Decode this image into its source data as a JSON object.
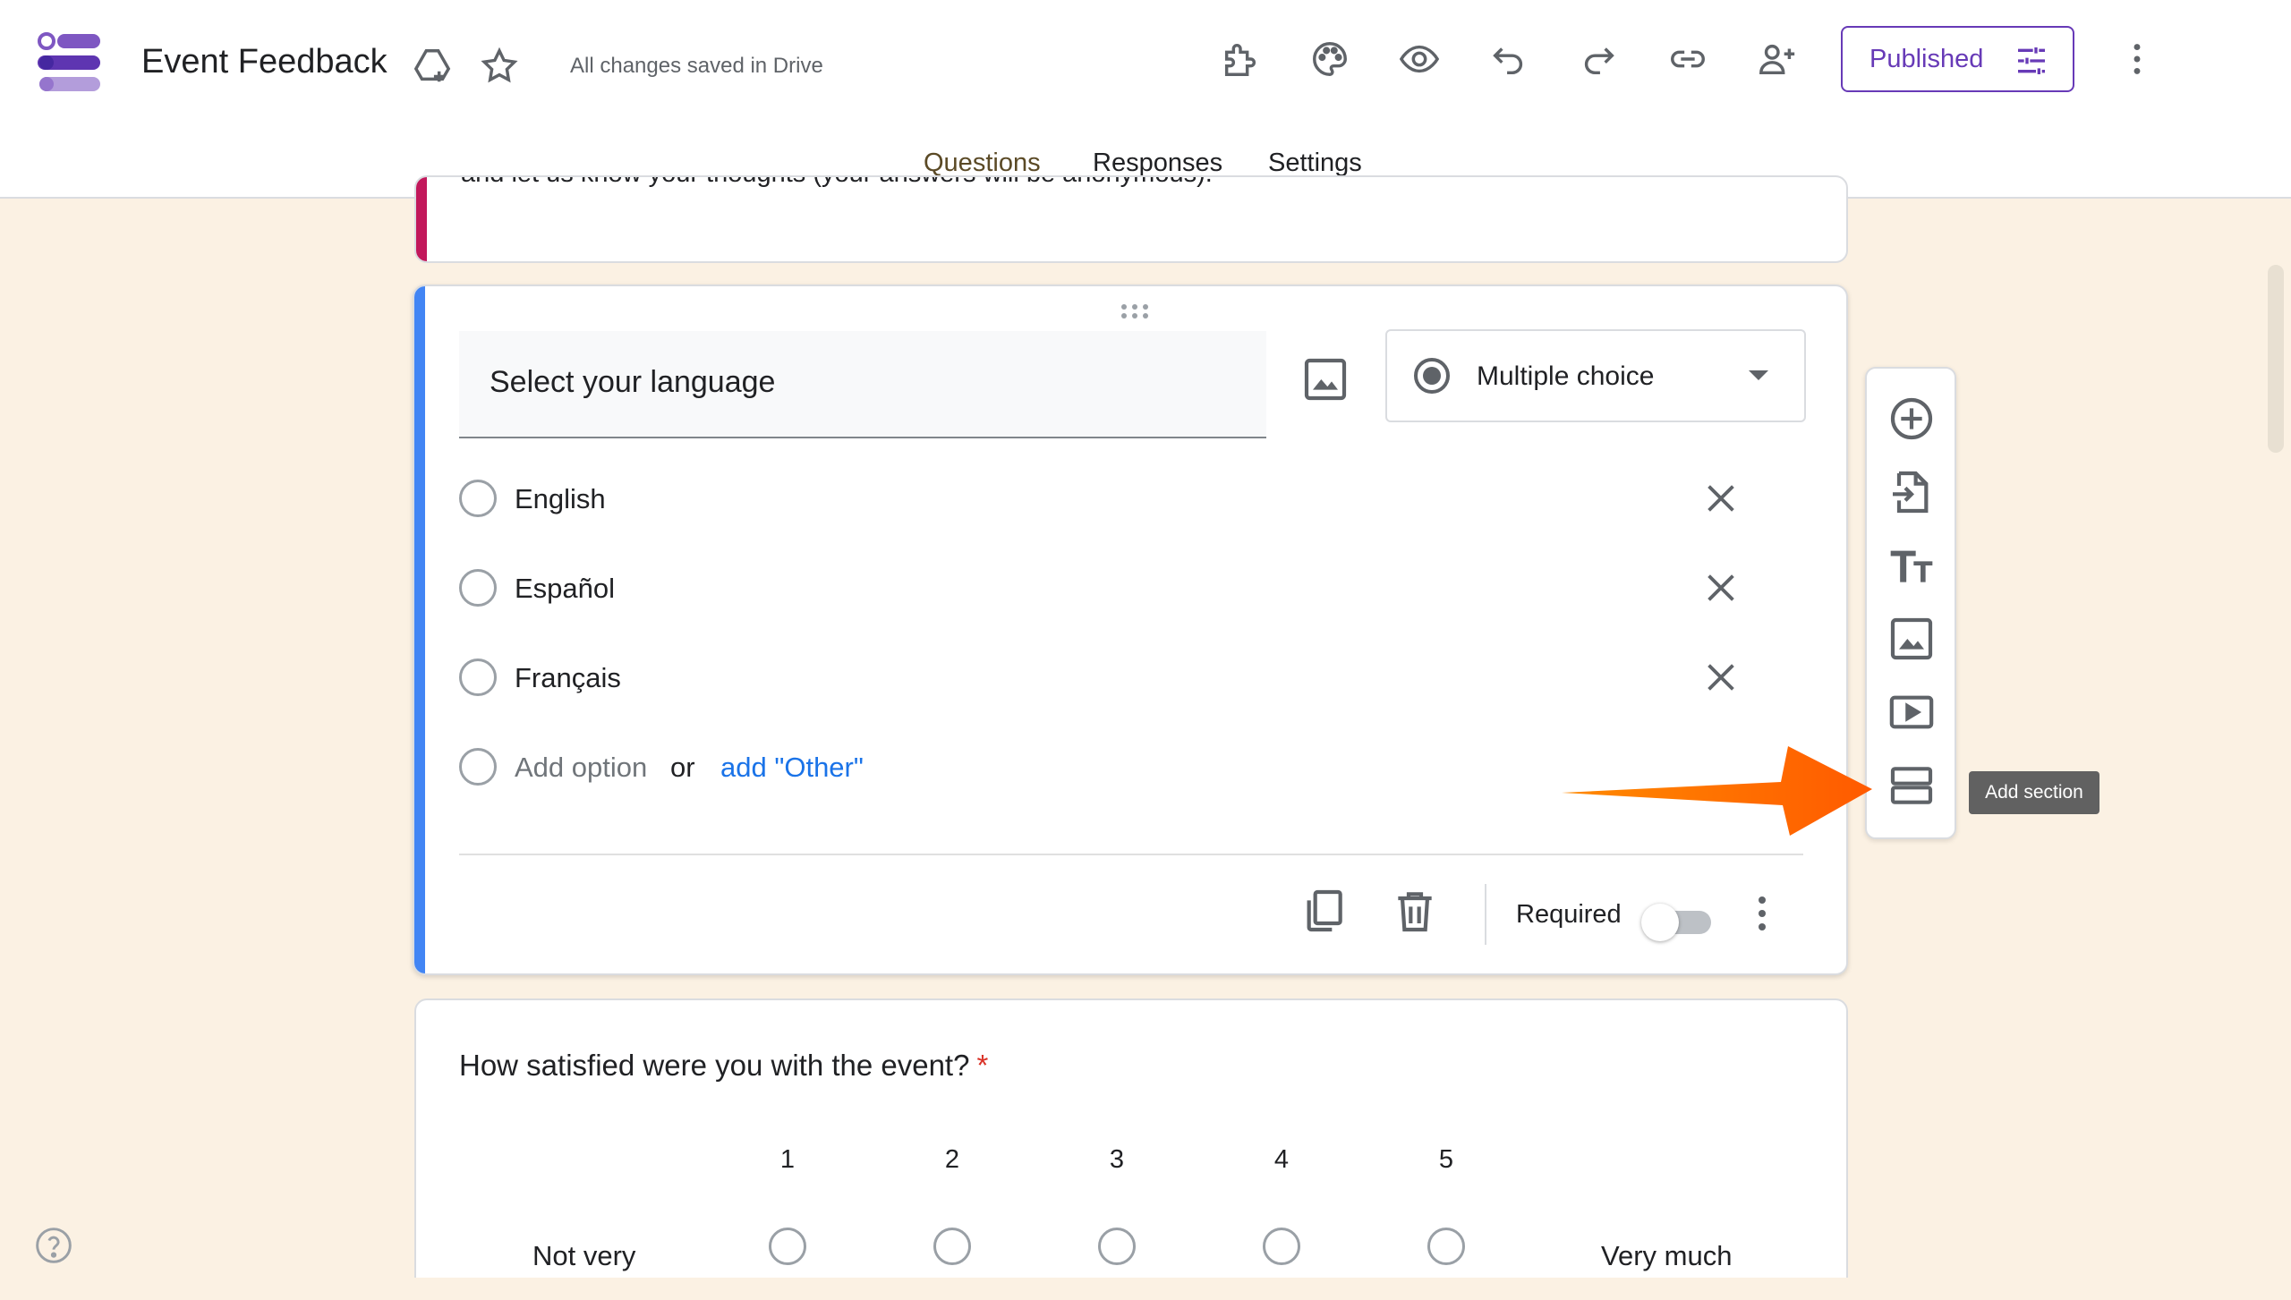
{
  "header": {
    "title": "Event Feedback",
    "saved_status": "All changes saved in Drive",
    "published_label": "Published",
    "icons": [
      "move-to-folder-icon",
      "star-icon",
      "addons-icon",
      "palette-icon",
      "preview-icon",
      "undo-icon",
      "redo-icon",
      "link-icon",
      "add-collaborator-icon",
      "more-icon"
    ]
  },
  "tabs": [
    {
      "label": "Questions",
      "active": true
    },
    {
      "label": "Responses",
      "active": false
    },
    {
      "label": "Settings",
      "active": false
    }
  ],
  "description": {
    "text": "and let us know your thoughts (your answers will be anonymous)."
  },
  "question": {
    "title": "Select your language",
    "type": "Multiple choice",
    "options": [
      "English",
      "Español",
      "Français"
    ],
    "add_option": "Add option",
    "or": "or",
    "add_other": "add \"Other\"",
    "required_label": "Required",
    "required": false
  },
  "satisfaction": {
    "title": "How satisfied were you with the event?",
    "required_mark": "*",
    "scale": [
      "1",
      "2",
      "3",
      "4",
      "5"
    ],
    "low_label": "Not very",
    "high_label": "Very much"
  },
  "toolbar": {
    "items": [
      "add-question",
      "import-questions",
      "add-title-description",
      "add-image",
      "add-video",
      "add-section"
    ],
    "tooltip": "Add section"
  },
  "colors": {
    "accent": "#673ab7",
    "arrow": "#ff6d00",
    "background": "#fbf1e3",
    "description_bar": "#c2185b",
    "active_bar": "#4285f4"
  }
}
